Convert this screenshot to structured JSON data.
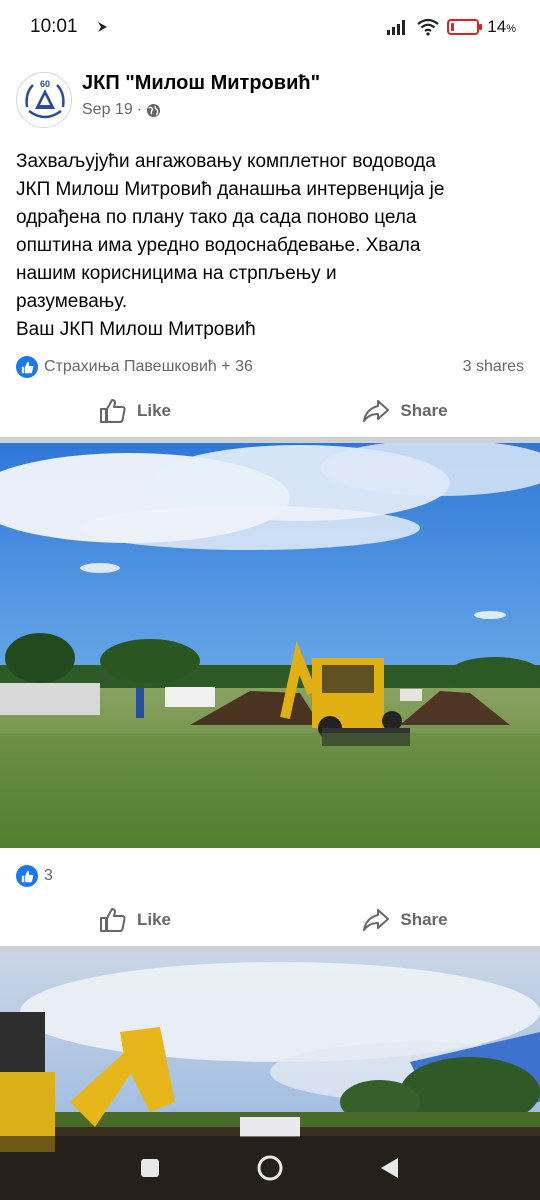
{
  "status_bar": {
    "time": "10:01",
    "battery_percent": "14",
    "battery_unit": "%",
    "battery_level": 0.14,
    "battery_color": "#e02020"
  },
  "post": {
    "page_name": "ЈКП \"Милош Митровић\"",
    "date": "Sep 19",
    "separator": "·",
    "audience_icon": "globe-icon",
    "logo_text": "60",
    "text_lines": [
      "Захваљујући ангажовању комплетног водовода",
      "ЈКП Милош Митровић данашња интервенција је",
      "одрађена по плану тако да сада поново цела",
      "општина има уредно водоснабдевање. Хвала",
      "нашим корисницима на стрпљењу и",
      "разумевању.",
      "Ваш ЈКП Милош Митровић"
    ],
    "reactions_text": "Страхиња Павешковић + 36",
    "shares_text": "3 shares",
    "like_label": "Like",
    "share_label": "Share"
  },
  "photo1": {
    "reaction_count": "3",
    "like_label": "Like",
    "share_label": "Share"
  },
  "colors": {
    "facebook_blue": "#1877f2",
    "text_primary": "#050505",
    "text_secondary": "#65676b",
    "separator": "#ced0d4"
  }
}
